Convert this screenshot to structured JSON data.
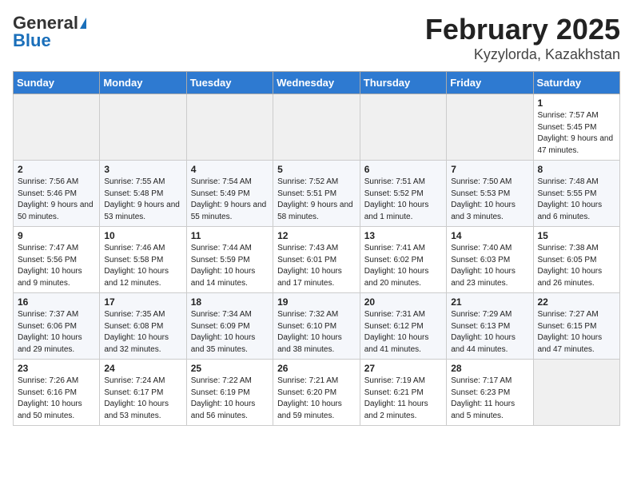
{
  "logo": {
    "line1": "General",
    "line2": "Blue"
  },
  "header": {
    "month": "February 2025",
    "location": "Kyzylorda, Kazakhstan"
  },
  "days_of_week": [
    "Sunday",
    "Monday",
    "Tuesday",
    "Wednesday",
    "Thursday",
    "Friday",
    "Saturday"
  ],
  "weeks": [
    [
      {
        "day": "",
        "info": ""
      },
      {
        "day": "",
        "info": ""
      },
      {
        "day": "",
        "info": ""
      },
      {
        "day": "",
        "info": ""
      },
      {
        "day": "",
        "info": ""
      },
      {
        "day": "",
        "info": ""
      },
      {
        "day": "1",
        "info": "Sunrise: 7:57 AM\nSunset: 5:45 PM\nDaylight: 9 hours and 47 minutes."
      }
    ],
    [
      {
        "day": "2",
        "info": "Sunrise: 7:56 AM\nSunset: 5:46 PM\nDaylight: 9 hours and 50 minutes."
      },
      {
        "day": "3",
        "info": "Sunrise: 7:55 AM\nSunset: 5:48 PM\nDaylight: 9 hours and 53 minutes."
      },
      {
        "day": "4",
        "info": "Sunrise: 7:54 AM\nSunset: 5:49 PM\nDaylight: 9 hours and 55 minutes."
      },
      {
        "day": "5",
        "info": "Sunrise: 7:52 AM\nSunset: 5:51 PM\nDaylight: 9 hours and 58 minutes."
      },
      {
        "day": "6",
        "info": "Sunrise: 7:51 AM\nSunset: 5:52 PM\nDaylight: 10 hours and 1 minute."
      },
      {
        "day": "7",
        "info": "Sunrise: 7:50 AM\nSunset: 5:53 PM\nDaylight: 10 hours and 3 minutes."
      },
      {
        "day": "8",
        "info": "Sunrise: 7:48 AM\nSunset: 5:55 PM\nDaylight: 10 hours and 6 minutes."
      }
    ],
    [
      {
        "day": "9",
        "info": "Sunrise: 7:47 AM\nSunset: 5:56 PM\nDaylight: 10 hours and 9 minutes."
      },
      {
        "day": "10",
        "info": "Sunrise: 7:46 AM\nSunset: 5:58 PM\nDaylight: 10 hours and 12 minutes."
      },
      {
        "day": "11",
        "info": "Sunrise: 7:44 AM\nSunset: 5:59 PM\nDaylight: 10 hours and 14 minutes."
      },
      {
        "day": "12",
        "info": "Sunrise: 7:43 AM\nSunset: 6:01 PM\nDaylight: 10 hours and 17 minutes."
      },
      {
        "day": "13",
        "info": "Sunrise: 7:41 AM\nSunset: 6:02 PM\nDaylight: 10 hours and 20 minutes."
      },
      {
        "day": "14",
        "info": "Sunrise: 7:40 AM\nSunset: 6:03 PM\nDaylight: 10 hours and 23 minutes."
      },
      {
        "day": "15",
        "info": "Sunrise: 7:38 AM\nSunset: 6:05 PM\nDaylight: 10 hours and 26 minutes."
      }
    ],
    [
      {
        "day": "16",
        "info": "Sunrise: 7:37 AM\nSunset: 6:06 PM\nDaylight: 10 hours and 29 minutes."
      },
      {
        "day": "17",
        "info": "Sunrise: 7:35 AM\nSunset: 6:08 PM\nDaylight: 10 hours and 32 minutes."
      },
      {
        "day": "18",
        "info": "Sunrise: 7:34 AM\nSunset: 6:09 PM\nDaylight: 10 hours and 35 minutes."
      },
      {
        "day": "19",
        "info": "Sunrise: 7:32 AM\nSunset: 6:10 PM\nDaylight: 10 hours and 38 minutes."
      },
      {
        "day": "20",
        "info": "Sunrise: 7:31 AM\nSunset: 6:12 PM\nDaylight: 10 hours and 41 minutes."
      },
      {
        "day": "21",
        "info": "Sunrise: 7:29 AM\nSunset: 6:13 PM\nDaylight: 10 hours and 44 minutes."
      },
      {
        "day": "22",
        "info": "Sunrise: 7:27 AM\nSunset: 6:15 PM\nDaylight: 10 hours and 47 minutes."
      }
    ],
    [
      {
        "day": "23",
        "info": "Sunrise: 7:26 AM\nSunset: 6:16 PM\nDaylight: 10 hours and 50 minutes."
      },
      {
        "day": "24",
        "info": "Sunrise: 7:24 AM\nSunset: 6:17 PM\nDaylight: 10 hours and 53 minutes."
      },
      {
        "day": "25",
        "info": "Sunrise: 7:22 AM\nSunset: 6:19 PM\nDaylight: 10 hours and 56 minutes."
      },
      {
        "day": "26",
        "info": "Sunrise: 7:21 AM\nSunset: 6:20 PM\nDaylight: 10 hours and 59 minutes."
      },
      {
        "day": "27",
        "info": "Sunrise: 7:19 AM\nSunset: 6:21 PM\nDaylight: 11 hours and 2 minutes."
      },
      {
        "day": "28",
        "info": "Sunrise: 7:17 AM\nSunset: 6:23 PM\nDaylight: 11 hours and 5 minutes."
      },
      {
        "day": "",
        "info": ""
      }
    ]
  ]
}
